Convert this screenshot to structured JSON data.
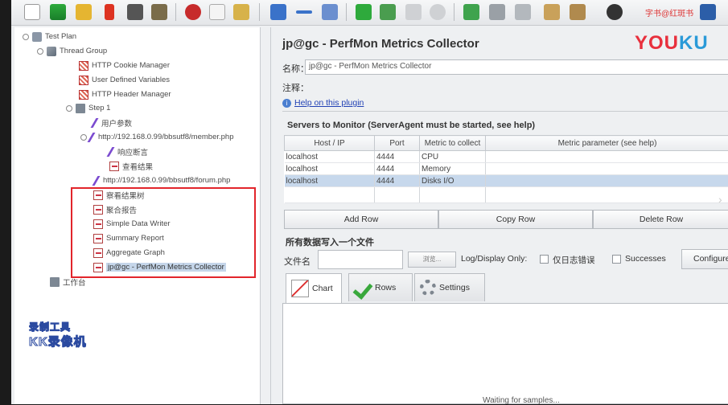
{
  "toolbar": {
    "overlay_text": "字书@红斑书"
  },
  "tree": {
    "items": [
      {
        "label": "Test Plan"
      },
      {
        "label": "Thread Group"
      },
      {
        "label": "HTTP Cookie Manager"
      },
      {
        "label": "User Defined Variables"
      },
      {
        "label": "HTTP Header Manager"
      },
      {
        "label": "Step 1"
      },
      {
        "label": "用户参数"
      },
      {
        "label": "http://192.168.0.99/bbsutf8/member.php"
      },
      {
        "label": "响应断言"
      },
      {
        "label": "查看结果"
      },
      {
        "label": "http://192.168.0.99/bbsutf8/forum.php"
      },
      {
        "label": "察看结果树"
      },
      {
        "label": "聚合报告"
      },
      {
        "label": "Simple Data Writer"
      },
      {
        "label": "Summary Report"
      },
      {
        "label": "Aggregate Graph"
      },
      {
        "label": "jp@gc - PerfMon Metrics Collector"
      },
      {
        "label": "工作台"
      }
    ]
  },
  "watermark": {
    "line1": "录制工具",
    "line2": "KK录像机"
  },
  "panel": {
    "title": "jp@gc - PerfMon Metrics Collector",
    "logo_you": "YOU",
    "logo_ku": "KU",
    "name_label": "名称：",
    "name_value": "jp@gc - PerfMon Metrics Collector",
    "comment_label": "注释：",
    "help_link": "Help on this plugin",
    "servers_title": "Servers to Monitor (ServerAgent must be started, see help)",
    "table": {
      "headers": [
        "Host / IP",
        "Port",
        "Metric to collect",
        "Metric parameter (see help)"
      ],
      "rows": [
        {
          "host": "localhost",
          "port": "4444",
          "metric": "CPU",
          "param": ""
        },
        {
          "host": "localhost",
          "port": "4444",
          "metric": "Memory",
          "param": ""
        },
        {
          "host": "localhost",
          "port": "4444",
          "metric": "Disks I/O",
          "param": ""
        }
      ]
    },
    "buttons": {
      "add": "Add Row",
      "copy": "Copy Row",
      "delete": "Delete Row"
    },
    "save_label": "所有数据写入一个文件",
    "file_label": "文件名",
    "browse": "浏览...",
    "log_display": "Log/Display Only:",
    "errors_only": "仅日志错误",
    "successes": "Successes",
    "configure": "Configure",
    "tabs": {
      "chart": "Chart",
      "rows": "Rows",
      "settings": "Settings"
    },
    "waiting": "Waiting for samples..."
  }
}
